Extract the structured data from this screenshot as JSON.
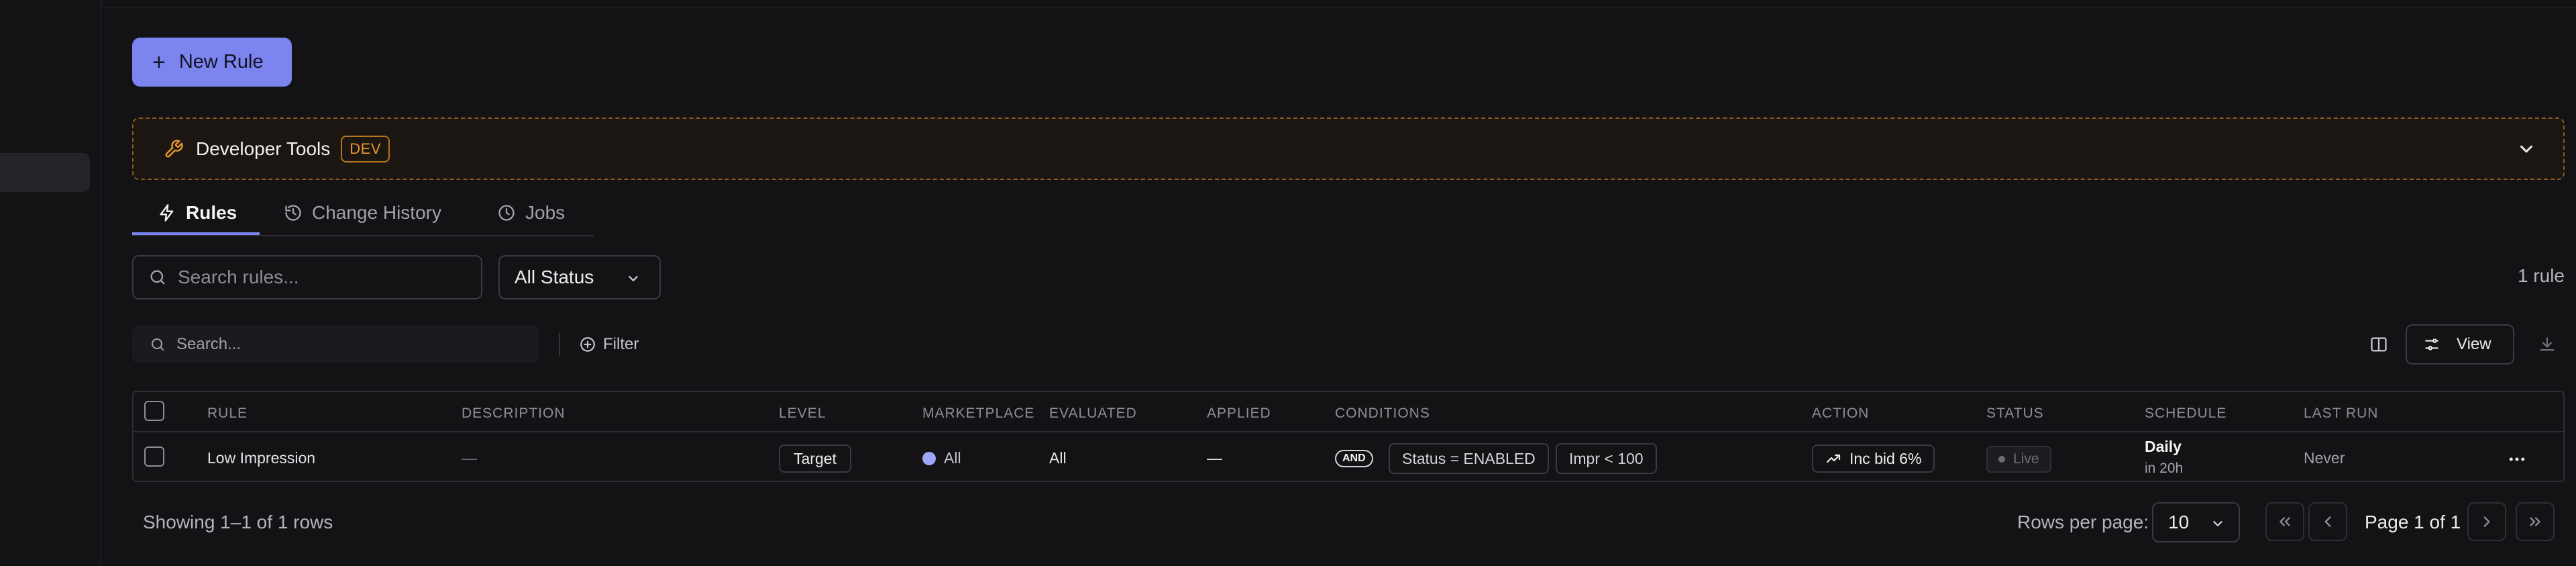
{
  "toolbar": {
    "new_rule_label": "New Rule"
  },
  "dev_tools": {
    "title": "Developer Tools",
    "badge": "DEV"
  },
  "tabs": [
    {
      "label": "Rules",
      "icon": "bolt-icon",
      "active": true
    },
    {
      "label": "Change History",
      "icon": "history-icon",
      "active": false
    },
    {
      "label": "Jobs",
      "icon": "clock-icon",
      "active": false
    }
  ],
  "filters": {
    "search_placeholder": "Search rules...",
    "status_value": "All Status",
    "rule_count": "1 rule"
  },
  "table_toolbar": {
    "search_placeholder": "Search...",
    "filter_label": "Filter",
    "view_label": "View"
  },
  "table": {
    "columns": [
      "RULE",
      "DESCRIPTION",
      "LEVEL",
      "MARKETPLACE",
      "EVALUATED",
      "APPLIED",
      "CONDITIONS",
      "ACTION",
      "STATUS",
      "SCHEDULE",
      "LAST RUN"
    ],
    "rows": [
      {
        "rule": "Low Impression",
        "description": "—",
        "level": "Target",
        "marketplace": "All",
        "evaluated": "All",
        "applied": "—",
        "conditions_op": "AND",
        "conditions": [
          "Status = ENABLED",
          "Impr < 100"
        ],
        "action": "Inc bid 6%",
        "status": "Live",
        "schedule": "Daily",
        "schedule_next": "in 20h",
        "last_run": "Never"
      }
    ]
  },
  "footer": {
    "showing": "Showing 1–1 of 1 rows",
    "rows_per_page_label": "Rows per page:",
    "rows_per_page_value": "10",
    "page_label": "Page 1 of 1"
  },
  "colors": {
    "accent": "#7c84f0",
    "dev_border": "#8a5a1c",
    "dev_badge": "#e7972e",
    "background": "#131316"
  }
}
